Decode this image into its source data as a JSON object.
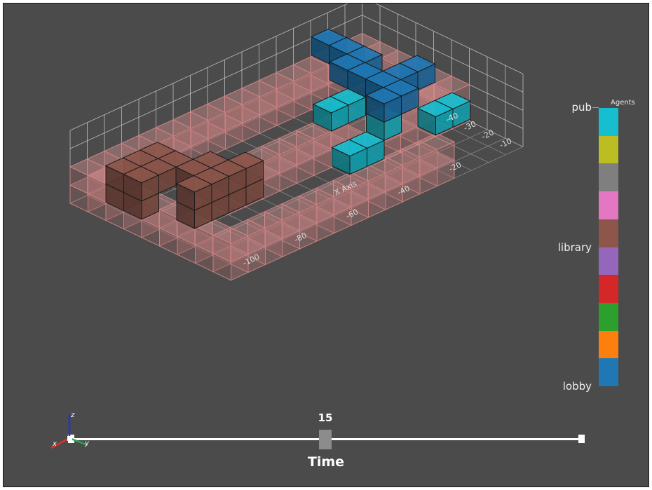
{
  "legend": {
    "title": "Agents",
    "labels": {
      "top": "pub",
      "middle": "library",
      "bottom": "lobby"
    },
    "colors": [
      "#17becf",
      "#bcbd22",
      "#7f7f7f",
      "#e377c2",
      "#8c564b",
      "#9467bd",
      "#d62728",
      "#2ca02c",
      "#ff7f0e",
      "#1f77b4"
    ]
  },
  "time_slider": {
    "title": "Time",
    "value": "15"
  },
  "scene": {
    "x_axis_label": "X Axis",
    "y_axis_ticks": [
      "-40",
      "-30",
      "-20",
      "-10"
    ],
    "x_axis_ticks": [
      "-100",
      "-80",
      "-60",
      "-40",
      "-20"
    ],
    "orientation_axes": [
      "x",
      "y",
      "z"
    ],
    "colors": {
      "background": "#4b4b4b",
      "wall_fill": "#e89a9a",
      "library_agent": "#8c564b",
      "lobby_agent": "#1f77b4",
      "pub_agent": "#17becf"
    }
  }
}
